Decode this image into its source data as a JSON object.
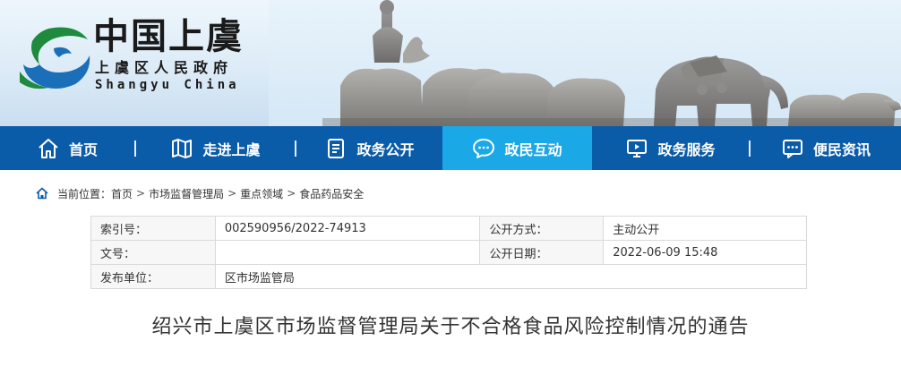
{
  "header": {
    "title": "中国上虞",
    "subtitle": "上虞区人民政府",
    "english": "Shangyu China"
  },
  "nav": {
    "items": [
      {
        "label": "首页",
        "icon": "home-icon"
      },
      {
        "label": "走进上虞",
        "icon": "map-icon"
      },
      {
        "label": "政务公开",
        "icon": "document-icon"
      },
      {
        "label": "政民互动",
        "icon": "chat-icon",
        "active": true
      },
      {
        "label": "政务服务",
        "icon": "monitor-icon"
      },
      {
        "label": "便民资讯",
        "icon": "message-icon"
      }
    ],
    "active_color": "#1aa8e6",
    "bar_color": "#0a5ba8"
  },
  "breadcrumb": {
    "prefix": "当前位置：",
    "items": [
      "首页",
      "市场监督管理局",
      "重点领域",
      "食品药品安全"
    ]
  },
  "meta": {
    "index_label": "索引号：",
    "index_value": "002590956/2022-74913",
    "method_label": "公开方式：",
    "method_value": "主动公开",
    "doc_label": "文号：",
    "doc_value": "",
    "date_label": "公开日期：",
    "date_value": "2022-06-09 15:48",
    "unit_label": "发布单位：",
    "unit_value": "区市场监管局"
  },
  "article": {
    "title": "绍兴市上虞区市场监督管理局关于不合格食品风险控制情况的通告"
  }
}
